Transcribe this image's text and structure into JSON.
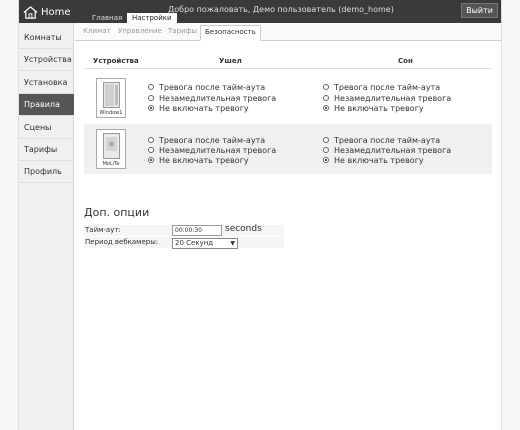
{
  "header": {
    "logo_text": "Home",
    "tabs": [
      {
        "label": "Главная"
      },
      {
        "label": "Настройки"
      }
    ],
    "welcome": "Добро пожаловать, Демо пользователь (demo_home)",
    "logout_label": "Выйти"
  },
  "sidebar": {
    "items": [
      {
        "label": "Комнаты"
      },
      {
        "label": "Устройства"
      },
      {
        "label": "Установка"
      },
      {
        "label": "Правила"
      },
      {
        "label": "Сцены"
      },
      {
        "label": "Тарифы"
      },
      {
        "label": "Профиль"
      }
    ],
    "active_index": 3
  },
  "subtabs": [
    {
      "label": "Климат"
    },
    {
      "label": "Управление"
    },
    {
      "label": "Тарифы"
    },
    {
      "label": "Безопасность"
    }
  ],
  "security": {
    "columns": {
      "devices": "Устройства",
      "away": "Ушел",
      "sleep": "Сон"
    },
    "options": [
      "Тревога после тайм-аута",
      "Незамедлительная тревога",
      "Не включать тревогу"
    ],
    "devices": [
      {
        "name": "Window1",
        "away_selected": 2,
        "sleep_selected": 2
      },
      {
        "name": "MoLiTe",
        "away_selected": 2,
        "sleep_selected": 2
      }
    ]
  },
  "extra": {
    "title": "Доп. опции",
    "timeout_label": "Тайм-аут:",
    "timeout_value": "00:00:30",
    "timeout_unit": "seconds",
    "webcam_label": "Период вебкамеры:",
    "webcam_value": "20 Секунд"
  },
  "colors": {
    "header_bg": "#3a3a3a",
    "active_sidebar": "#555555",
    "row_alt": "#f0f0f0"
  }
}
